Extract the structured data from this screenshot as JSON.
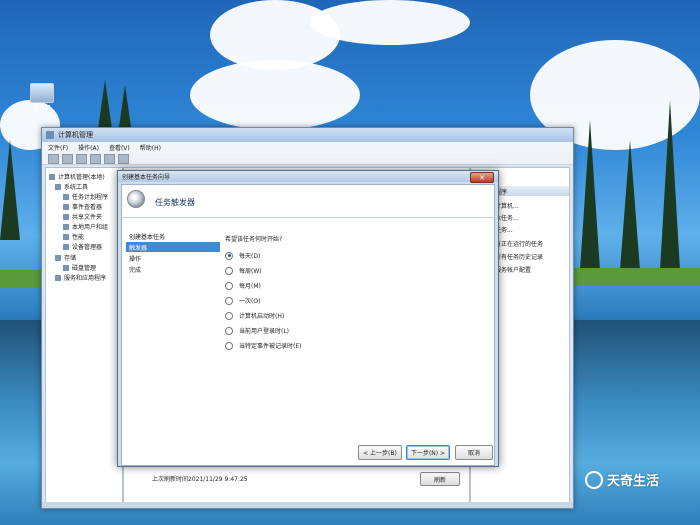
{
  "desktop": {
    "icon_label": "计算机"
  },
  "mmc": {
    "title": "计算机管理",
    "menu": [
      "文件(F)",
      "操作(A)",
      "查看(V)",
      "帮助(H)"
    ],
    "tree": [
      "计算机管理(本地)",
      "系统工具",
      "任务计划程序",
      "事件查看器",
      "共享文件夹",
      "本地用户和组",
      "性能",
      "设备管理器",
      "存储",
      "磁盘管理",
      "服务和应用程序"
    ],
    "status": "上次刷新时间2021/11/29 9:47:25",
    "refresh_label": "刷新",
    "actions": {
      "header": "程序",
      "items": [
        "计算机...",
        "本任务...",
        "任务...",
        "有正在运行的任务",
        "所有任务历史记录",
        "服务帐户配置",
        "",
        "",
        ""
      ]
    }
  },
  "wizard": {
    "window_title": "创建基本任务向导",
    "close_glyph": "✕",
    "heading": "任务触发器",
    "steps": [
      "创建基本任务",
      "触发器",
      "操作",
      "完成"
    ],
    "active_step": 1,
    "question": "希望该任务何时开始?",
    "options": [
      "每天(D)",
      "每周(W)",
      "每月(M)",
      "一次(O)",
      "计算机启动时(H)",
      "当前用户登录时(L)",
      "当特定事件被记录时(E)"
    ],
    "selected_option": 0,
    "buttons": {
      "back": "< 上一步(B)",
      "next": "下一步(N) >",
      "cancel": "取消"
    }
  },
  "watermark": {
    "text": "天奇生活"
  }
}
